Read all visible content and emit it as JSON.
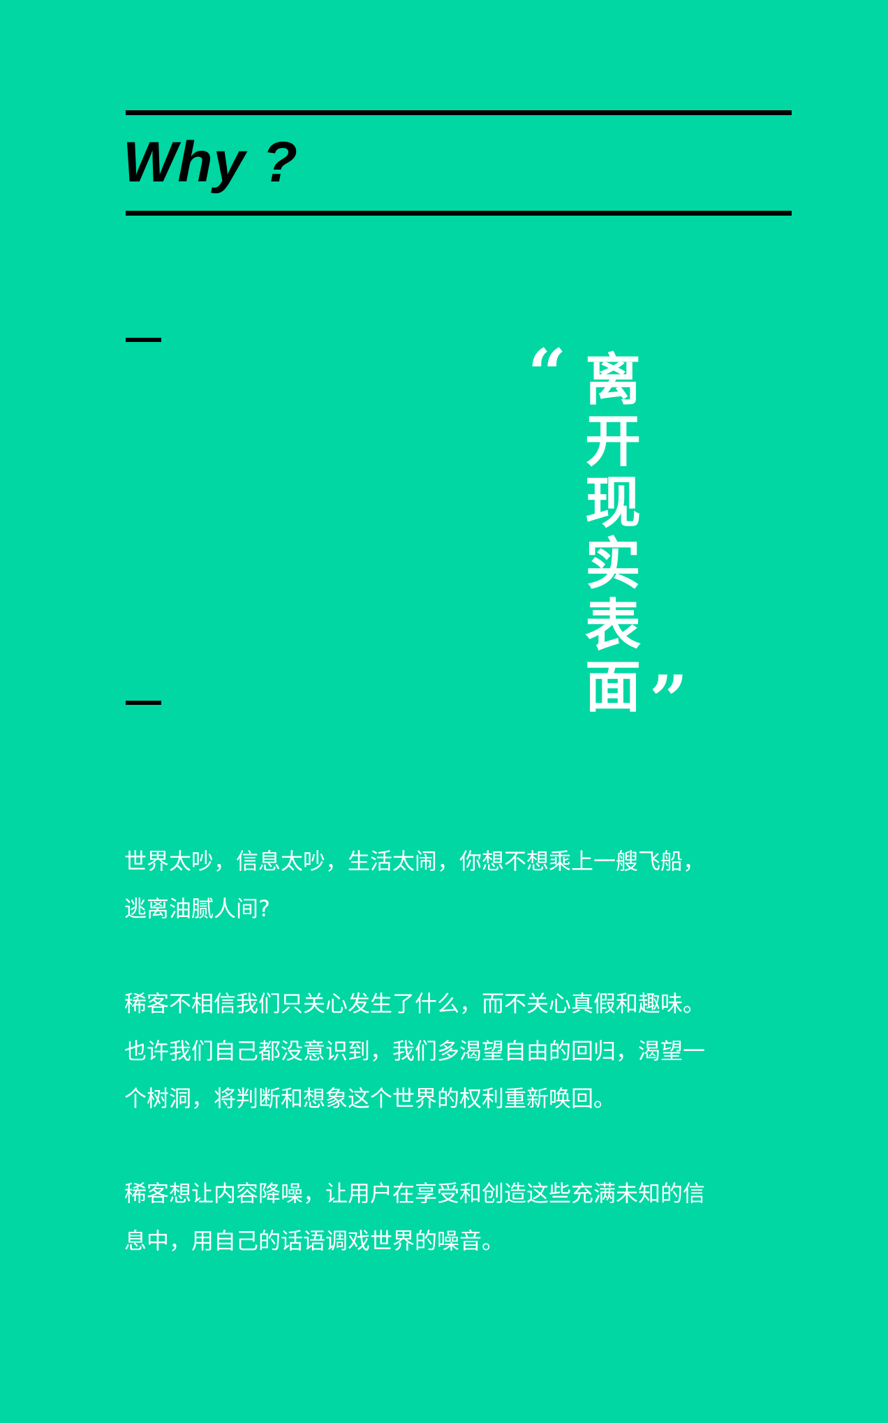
{
  "header": {
    "title": "Why ?"
  },
  "quote": {
    "open_mark": "“",
    "close_mark": "”",
    "characters": [
      "离",
      "开",
      "现",
      "实",
      "表",
      "面"
    ]
  },
  "paragraphs": [
    [
      "世界太吵，信息太吵，生活太闹，你想不想乘上一艘飞船，",
      "逃离油腻人间?"
    ],
    [
      "稀客不相信我们只关心发生了什么，而不关心真假和趣味。",
      "也许我们自己都没意识到，我们多渴望自由的回归，渴望一",
      "个树洞，将判断和想象这个世界的权利重新唤回。"
    ],
    [
      "稀客想让内容降噪，让用户在享受和创造这些充满未知的信",
      "息中，用自己的话语调戏世界的噪音。"
    ]
  ]
}
